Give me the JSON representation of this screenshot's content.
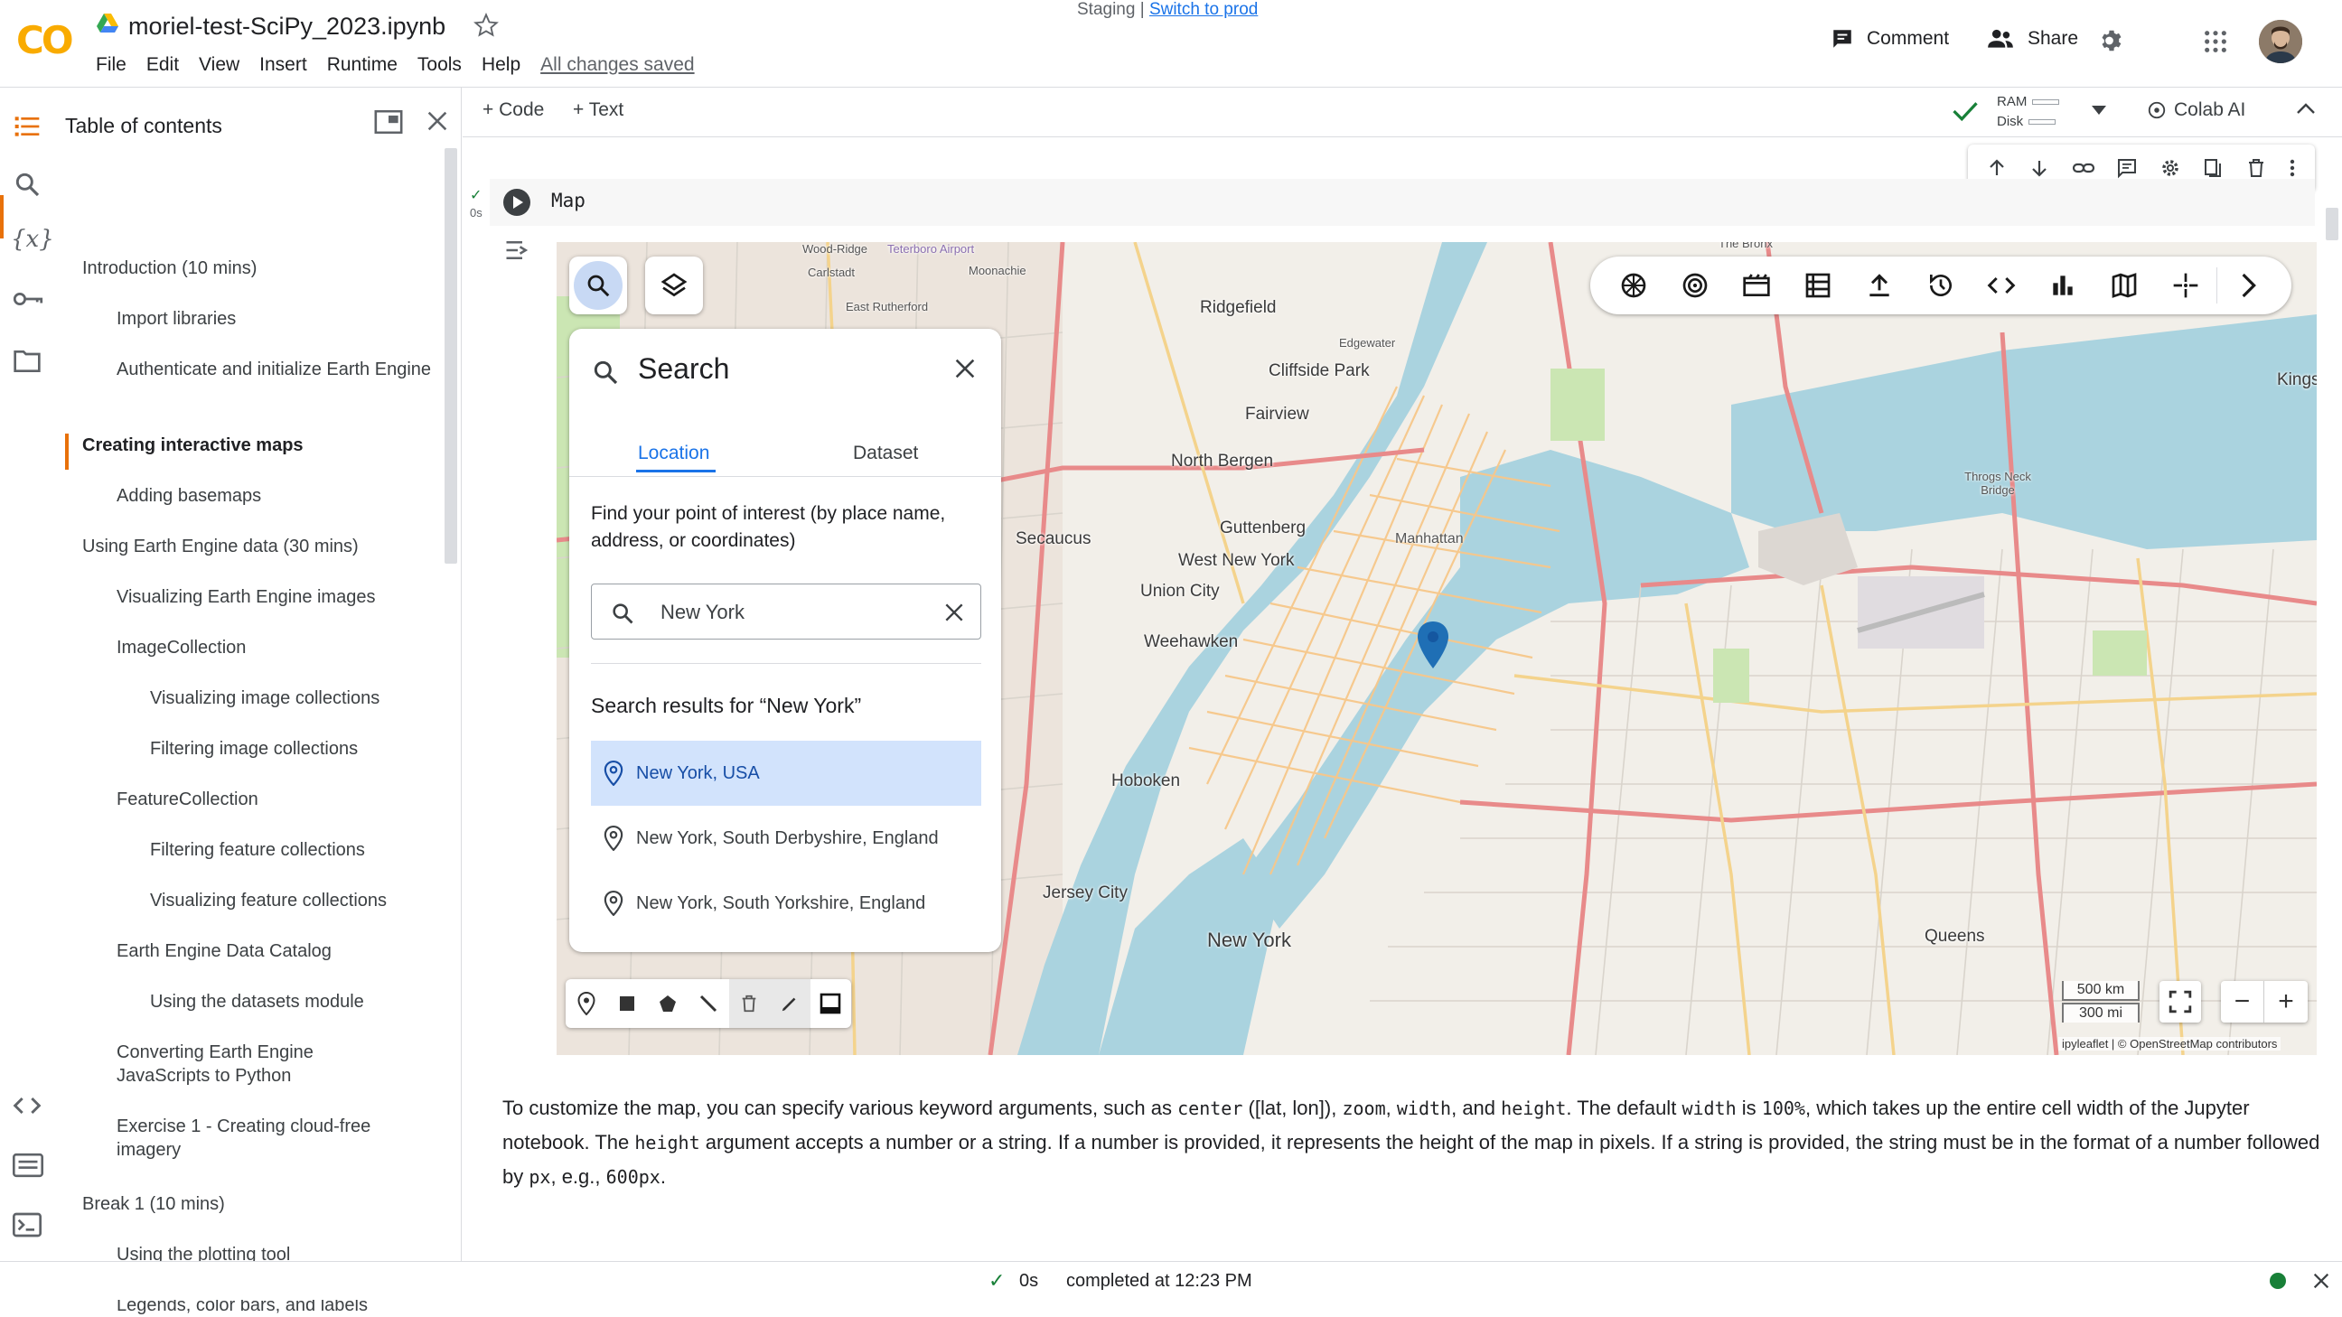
{
  "app": {
    "logo_text": "CO",
    "notebook_title": "moriel-test-SciPy_2023.ipynb",
    "staging_label": "Staging |",
    "switch_link": "Switch to prod",
    "menu": [
      "File",
      "Edit",
      "View",
      "Insert",
      "Runtime",
      "Tools",
      "Help"
    ],
    "save_status": "All changes saved",
    "comment_label": "Comment",
    "share_label": "Share",
    "accent_color": "#e8710a"
  },
  "toc": {
    "title": "Table of contents",
    "items": [
      {
        "label": "Introduction (10 mins)",
        "level": 1
      },
      {
        "label": "Import libraries",
        "level": 2
      },
      {
        "label": "Authenticate and initialize Earth Engine",
        "level": 2
      },
      {
        "label": "Creating interactive maps",
        "level": 1,
        "active": true
      },
      {
        "label": "Adding basemaps",
        "level": 2
      },
      {
        "label": "Using Earth Engine data (30 mins)",
        "level": 1
      },
      {
        "label": "Visualizing Earth Engine images",
        "level": 2
      },
      {
        "label": "ImageCollection",
        "level": 2
      },
      {
        "label": "Visualizing image collections",
        "level": 3
      },
      {
        "label": "Filtering image collections",
        "level": 3
      },
      {
        "label": "FeatureCollection",
        "level": 2
      },
      {
        "label": "Filtering feature collections",
        "level": 3
      },
      {
        "label": "Visualizing feature collections",
        "level": 3
      },
      {
        "label": "Earth Engine Data Catalog",
        "level": 2
      },
      {
        "label": "Using the datasets module",
        "level": 3
      },
      {
        "label": "Converting Earth Engine JavaScripts to Python",
        "level": 2
      },
      {
        "label": "Exercise 1 - Creating cloud-free imagery",
        "level": 2
      },
      {
        "label": "Break 1 (10 mins)",
        "level": 1
      },
      {
        "label": "Using the plotting tool",
        "level": 2
      },
      {
        "label": "Legends, color bars, and labels",
        "level": 2
      }
    ]
  },
  "toolbar": {
    "add_code": "+ Code",
    "add_text": "+ Text",
    "ram_label": "RAM",
    "disk_label": "Disk",
    "colab_ai": "Colab AI"
  },
  "cell": {
    "exec_time": "0s",
    "code": "Map"
  },
  "map": {
    "search_panel": {
      "title": "Search",
      "tab_location": "Location",
      "tab_dataset": "Dataset",
      "description": "Find your point of interest (by place name, address, or coordinates)",
      "input_value": "New York",
      "results_heading": "Search results for “New York”",
      "results": [
        "New York, USA",
        "New York, South Derbyshire, England",
        "New York, South Yorkshire, England"
      ]
    },
    "scale_km": "500 km",
    "scale_mi": "300 mi",
    "attribution": "ipyleaflet | © OpenStreetMap contributors",
    "labels": {
      "wood_ridge": "Wood-Ridge",
      "teterboro": "Teterboro Airport",
      "carlstadt": "Carlstadt",
      "moonachie": "Moonachie",
      "east_rutherford": "East Rutherford",
      "ridgefield": "Ridgefield",
      "edgewater": "Edgewater",
      "cliffside_park": "Cliffside Park",
      "fairview": "Fairview",
      "north_bergen": "North Bergen",
      "guttenberg": "Guttenberg",
      "secaucus": "Secaucus",
      "west_new_york": "West New York",
      "union_city": "Union City",
      "manhattan": "Manhattan",
      "weehawken": "Weehawken",
      "hoboken": "Hoboken",
      "jersey_city": "Jersey City",
      "new_york": "New York",
      "queens": "Queens",
      "throgs_neck": "Throgs Neck Bridge",
      "the_bronx": "The Bronx",
      "kings": "Kings"
    }
  },
  "text_cell": {
    "p1": "To customize the map, you can specify various keyword arguments, such as",
    "c_center": "center",
    "p2": "([lat, lon]),",
    "c_zoom": "zoom",
    "p3": ",",
    "c_width": "width",
    "p4": ", and",
    "c_height": "height",
    "p5": ". The default",
    "c_width2": "width",
    "p6": "is",
    "c_100": "100%",
    "p7": ", which takes up the entire cell width of the Jupyter notebook. The",
    "c_height2": "height",
    "p8": "argument accepts a number or a string. If a number is provided, it represents the height of the map in pixels. If a string is provided, the string must be in the format of a number followed by",
    "c_px": "px",
    "p9": ", e.g.,",
    "c_600": "600px",
    "p10": "."
  },
  "status": {
    "check": "✓",
    "time": "0s",
    "text": "completed at 12:23 PM"
  }
}
